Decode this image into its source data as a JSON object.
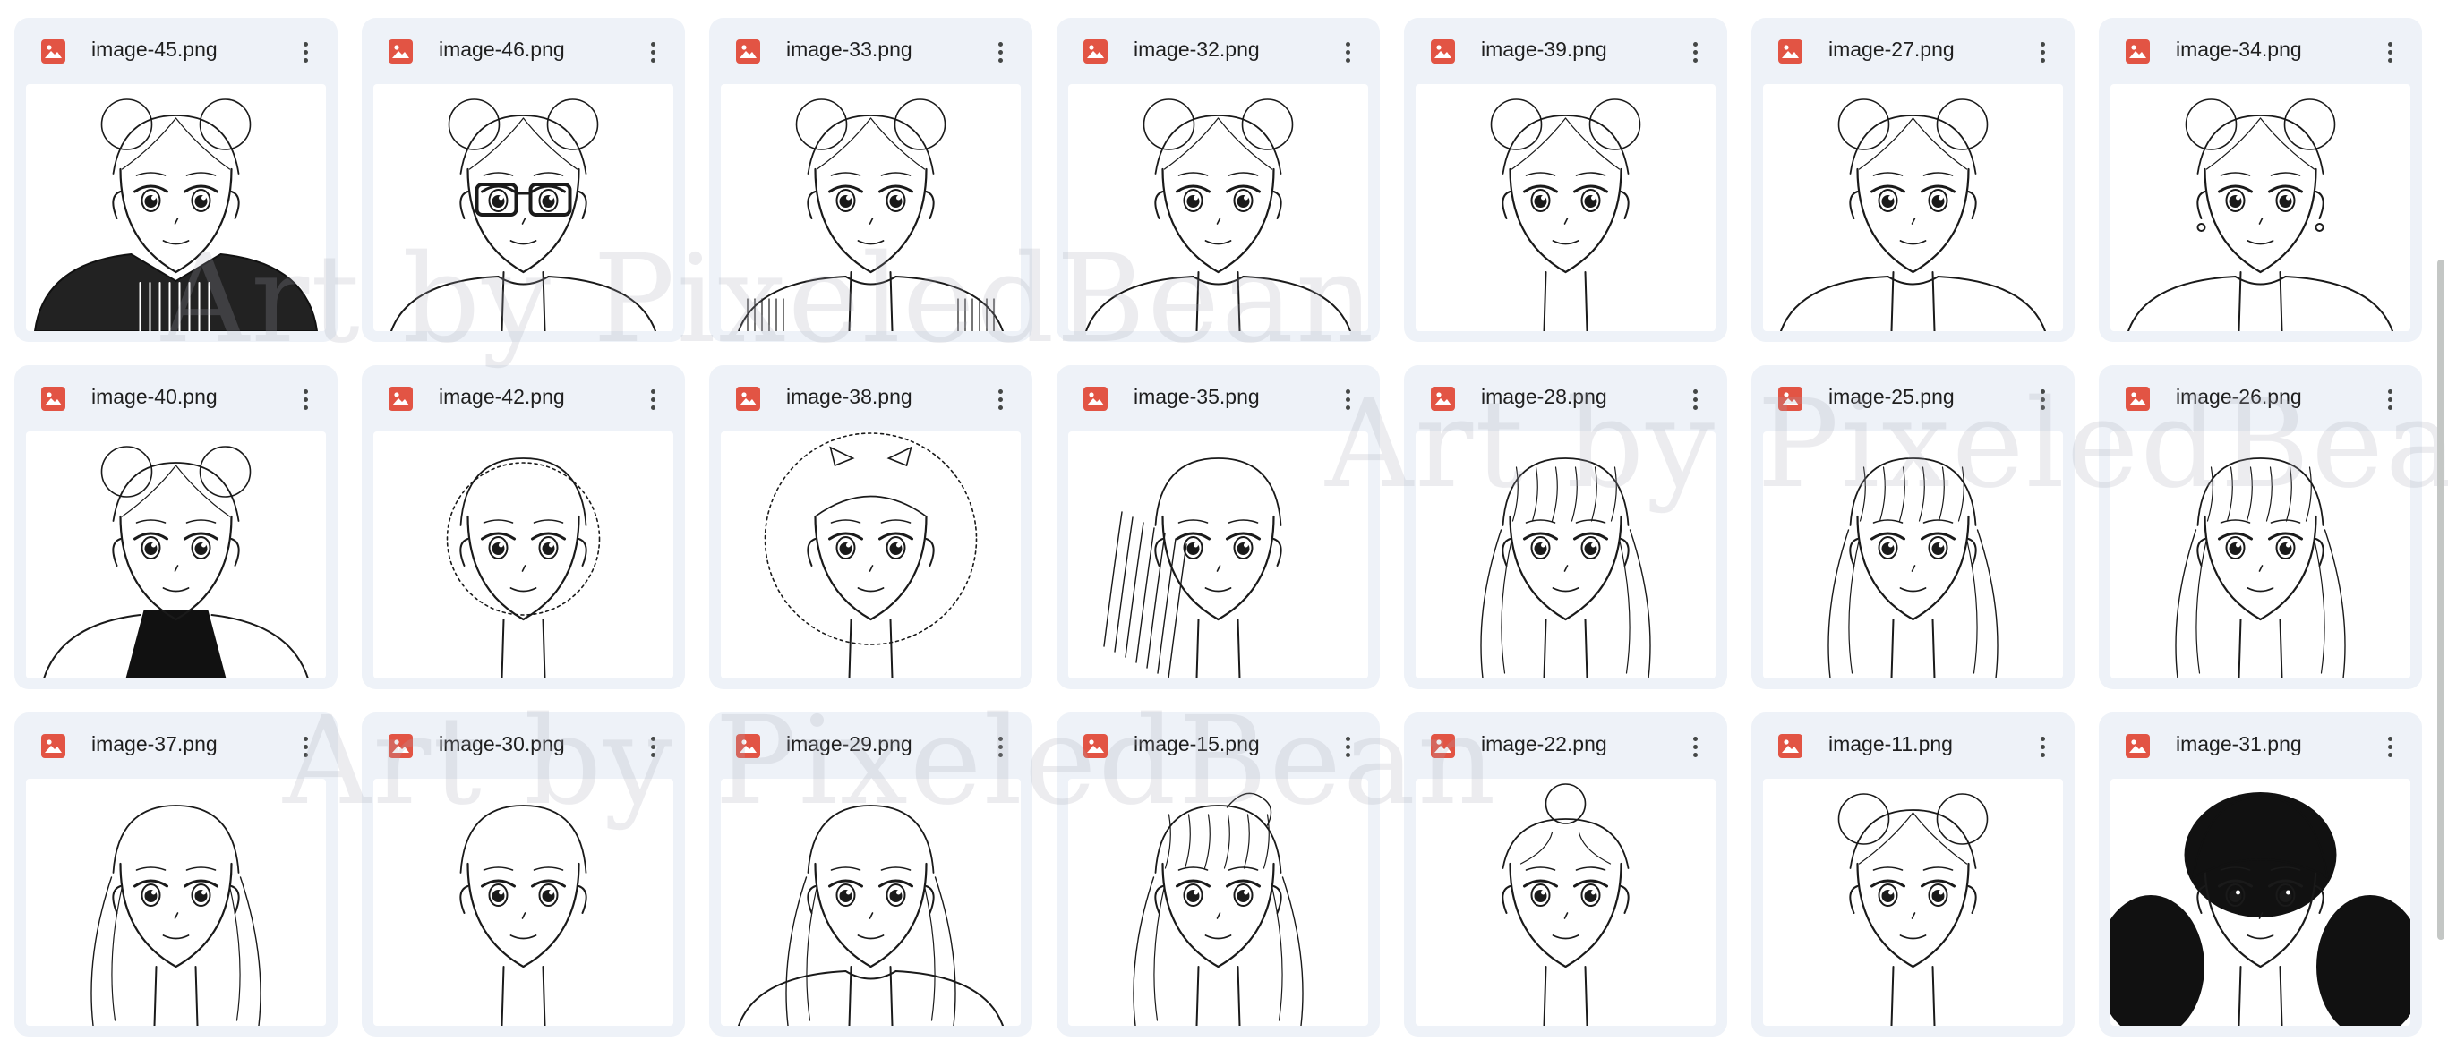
{
  "files": [
    {
      "name": "image-45.png",
      "hair": "buns",
      "outfit": "dark-jersey",
      "fill": false
    },
    {
      "name": "image-46.png",
      "hair": "buns",
      "outfit": "glasses-sweater",
      "fill": false
    },
    {
      "name": "image-33.png",
      "hair": "buns",
      "outfit": "cardigan",
      "fill": false
    },
    {
      "name": "image-32.png",
      "hair": "buns",
      "outfit": "crewneck",
      "fill": false
    },
    {
      "name": "image-39.png",
      "hair": "buns",
      "outfit": "none",
      "fill": false
    },
    {
      "name": "image-27.png",
      "hair": "buns",
      "outfit": "collar",
      "fill": false
    },
    {
      "name": "image-34.png",
      "hair": "buns",
      "outfit": "earrings",
      "fill": false
    },
    {
      "name": "image-40.png",
      "hair": "buns",
      "outfit": "turtleneck-jacket",
      "fill": false
    },
    {
      "name": "image-42.png",
      "hair": "short-curly",
      "outfit": "none",
      "fill": false
    },
    {
      "name": "image-38.png",
      "hair": "afro-bow",
      "outfit": "none",
      "fill": false
    },
    {
      "name": "image-35.png",
      "hair": "braids",
      "outfit": "none",
      "fill": false
    },
    {
      "name": "image-28.png",
      "hair": "long-wavy",
      "outfit": "none",
      "fill": false
    },
    {
      "name": "image-25.png",
      "hair": "curly-bangs",
      "outfit": "none",
      "fill": false
    },
    {
      "name": "image-26.png",
      "hair": "bob-bangs",
      "outfit": "none",
      "fill": false
    },
    {
      "name": "image-37.png",
      "hair": "long-straight",
      "outfit": "none",
      "fill": false
    },
    {
      "name": "image-30.png",
      "hair": "short-crop",
      "outfit": "none",
      "fill": false
    },
    {
      "name": "image-29.png",
      "hair": "long-straight",
      "outfit": "shoulders",
      "fill": false
    },
    {
      "name": "image-15.png",
      "hair": "ponytail",
      "outfit": "none",
      "fill": false
    },
    {
      "name": "image-22.png",
      "hair": "top-bun",
      "outfit": "none",
      "fill": false
    },
    {
      "name": "image-11.png",
      "hair": "buns",
      "outfit": "none",
      "fill": false
    },
    {
      "name": "image-31.png",
      "hair": "black-curly",
      "outfit": "none",
      "fill": true
    }
  ],
  "watermark": "Art by PixeledBean",
  "icons": {
    "file_type": "image-file-icon",
    "menu": "more-vert-icon"
  },
  "colors": {
    "card_bg": "#eef2f8",
    "file_icon": "#e25444",
    "text": "#1f1f1f"
  }
}
